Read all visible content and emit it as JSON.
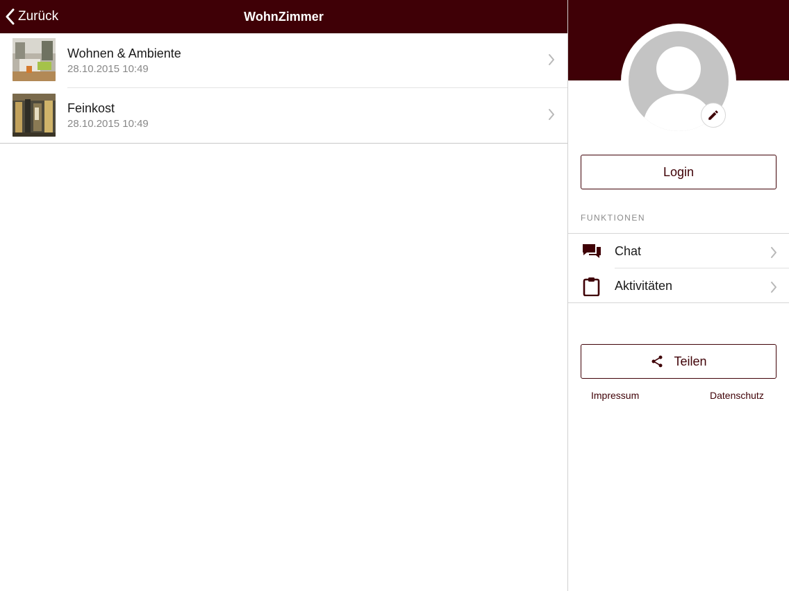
{
  "navbar": {
    "back_label": "Zurück",
    "title": "WohnZimmer",
    "background": "#3f0006",
    "icon": "chevron-left-icon"
  },
  "list": {
    "items": [
      {
        "title": "Wohnen & Ambiente",
        "date": "28.10.2015 10:49",
        "thumbnail": "room-photo-thumbnail"
      },
      {
        "title": "Feinkost",
        "date": "28.10.2015 10:49",
        "thumbnail": "shop-photo-thumbnail"
      }
    ]
  },
  "sidebar": {
    "avatar_icon": "user-placeholder-icon",
    "edit_icon": "pencil-icon",
    "login_label": "Login",
    "section_label": "FUNKTIONEN",
    "menu": [
      {
        "label": "Chat",
        "icon": "chat-bubbles-icon"
      },
      {
        "label": "Aktivitäten",
        "icon": "clipboard-icon"
      }
    ],
    "share_label": "Teilen",
    "share_icon": "share-icon",
    "impressum_label": "Impressum",
    "datenschutz_label": "Datenschutz"
  },
  "colors": {
    "accent": "#3f0006",
    "secondary_text": "#888888",
    "separator": "#e3e3e3"
  }
}
